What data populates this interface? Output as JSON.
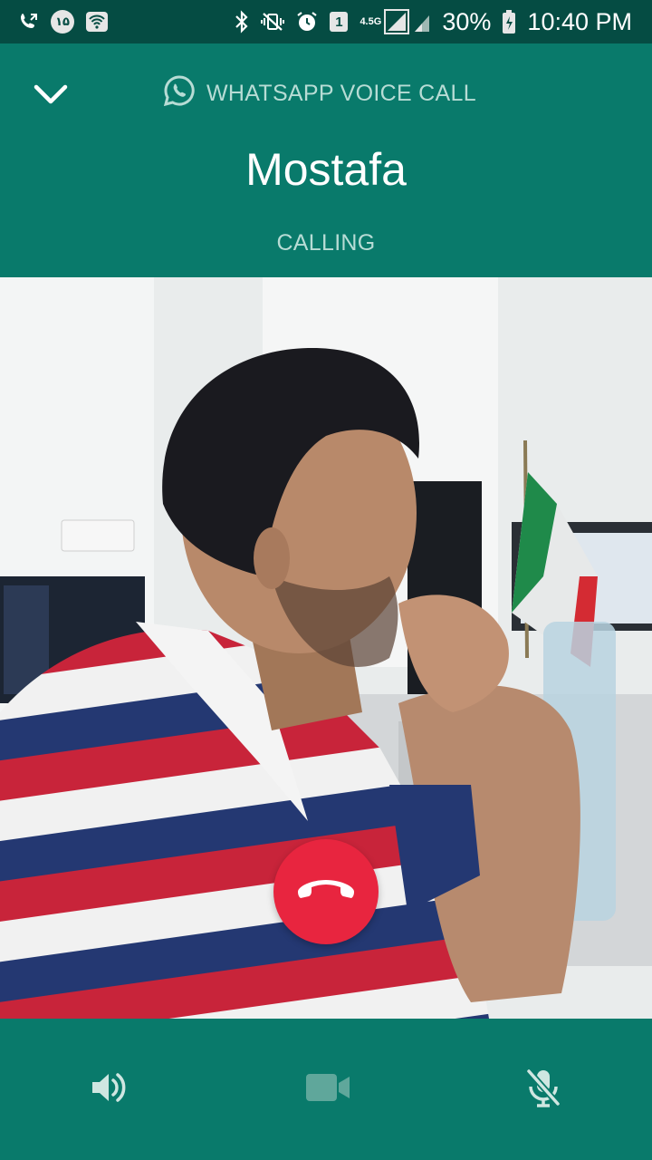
{
  "status_bar": {
    "left_badge": "۱۵",
    "sim_badge": "1",
    "network_type": "4.5G",
    "battery_percent": "30%",
    "time": "10:40 PM",
    "icons": [
      "call-forward-icon",
      "badge-icon",
      "wifi-icon",
      "bluetooth-icon",
      "vibrate-icon",
      "alarm-icon",
      "sim-icon",
      "signal-icon",
      "battery-icon"
    ]
  },
  "header": {
    "call_type": "WHATSAPP VOICE CALL",
    "contact_name": "Mostafa",
    "call_status": "CALLING"
  },
  "controls": {
    "end_call": "end-call-icon",
    "speaker": "speaker-icon",
    "video": "video-icon",
    "mute": "mic-off-icon"
  },
  "colors": {
    "header_bg": "#097a6b",
    "status_bg": "#054c43",
    "end_call_red": "#e8253f",
    "accent_text": "#b7dcd5"
  }
}
